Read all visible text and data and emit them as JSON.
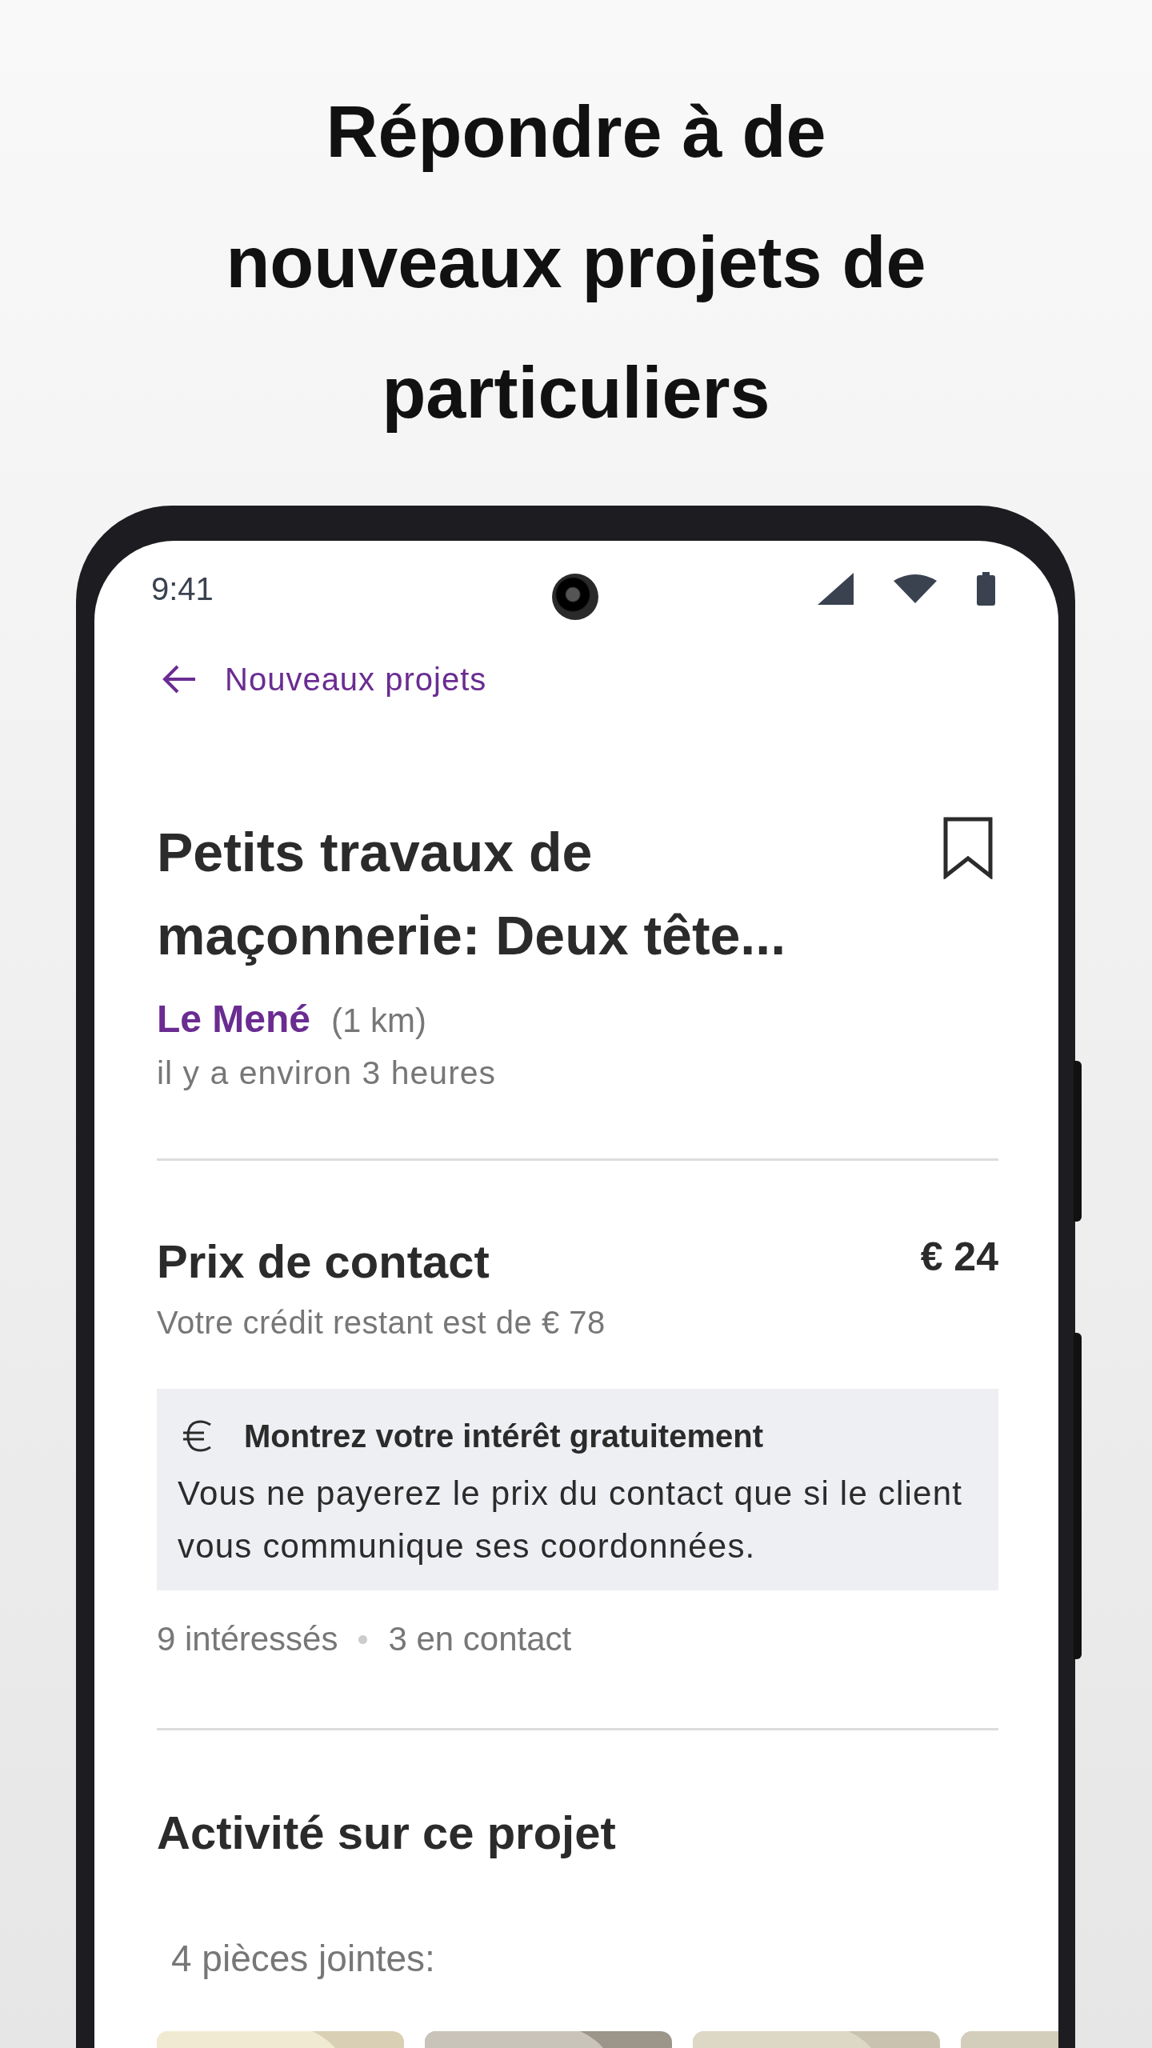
{
  "headline": "Répondre à de nouveaux projets de particuliers",
  "status_bar": {
    "time": "9:41"
  },
  "nav": {
    "back_label": "Nouveaux projets"
  },
  "project": {
    "title": "Petits travaux de maçonnerie: Deux tête...",
    "bookmarked": false,
    "location": "Le Mené",
    "distance": "(1 km)",
    "posted": "il y a environ 3 heures"
  },
  "price": {
    "label": "Prix de contact",
    "amount": "€ 24",
    "credit": "Votre crédit restant est de € 78"
  },
  "notice": {
    "title": "Montrez votre intérêt gratuitement",
    "body": "Vous ne payerez le prix du contact que si le client vous communique ses coordonnées."
  },
  "stats": [
    "9 intéressés",
    "3 en contact"
  ],
  "activity": {
    "title": "Activité sur ce projet",
    "attachments_label": "4 pièces jointes:"
  }
}
